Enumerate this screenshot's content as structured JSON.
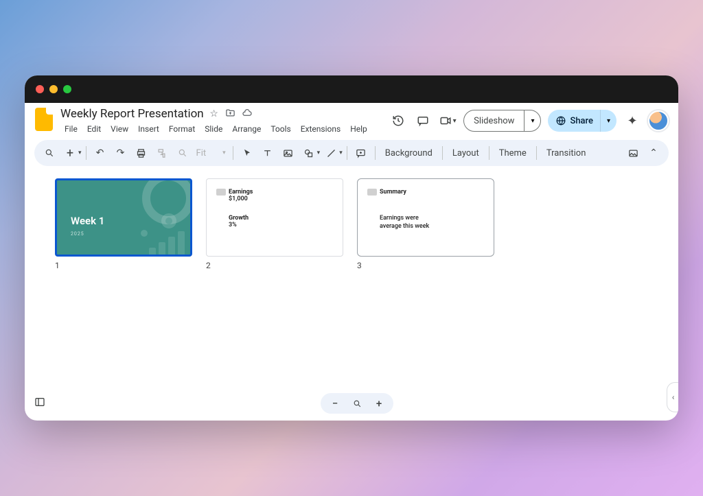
{
  "doc": {
    "title": "Weekly Report Presentation"
  },
  "menus": [
    "File",
    "Edit",
    "View",
    "Insert",
    "Format",
    "Slide",
    "Arrange",
    "Tools",
    "Extensions",
    "Help"
  ],
  "header": {
    "slideshow": "Slideshow",
    "share": "Share"
  },
  "toolbar": {
    "fit": "Fit",
    "background": "Background",
    "layout": "Layout",
    "theme": "Theme",
    "transition": "Transition"
  },
  "slides": [
    {
      "num": "1",
      "title": "Week 1",
      "sub": "2025"
    },
    {
      "num": "2",
      "h1": "Earnings",
      "v1": "$1,000",
      "h2": "Growth",
      "v2": "3%"
    },
    {
      "num": "3",
      "h1": "Summary",
      "body1": "Earnings were",
      "body2": "average this week"
    }
  ]
}
